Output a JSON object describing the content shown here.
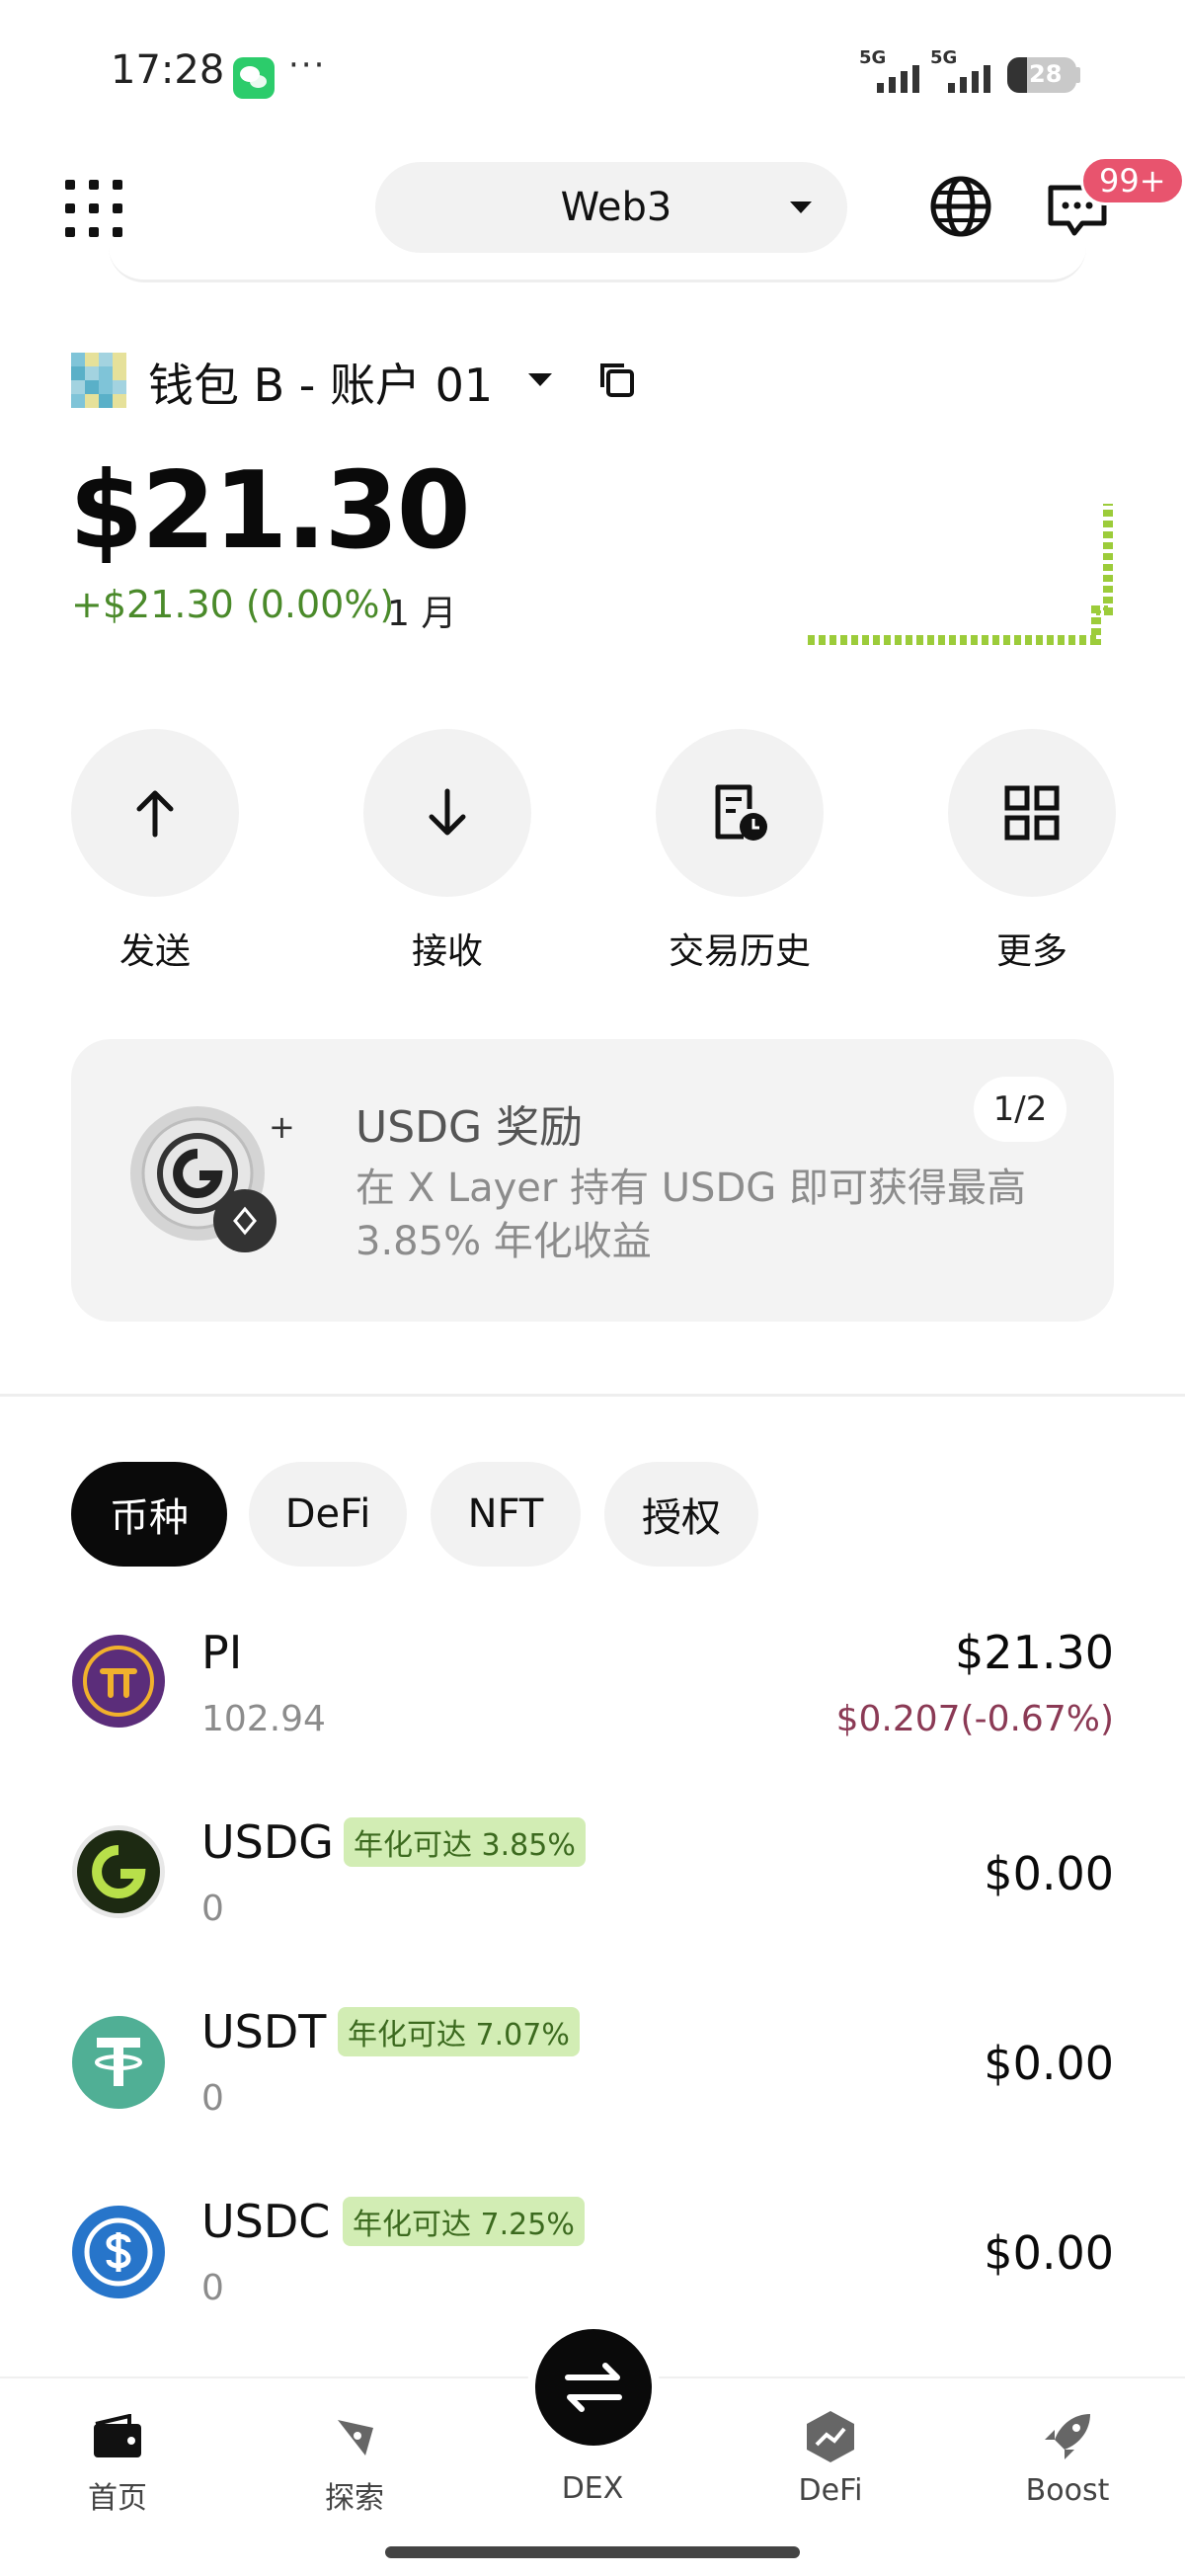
{
  "status_bar": {
    "time": "17:28",
    "more_dots": "···",
    "signal_1_label": "5G",
    "signal_2_label": "5G",
    "battery": "28",
    "battery_level": 0.28
  },
  "header": {
    "network_label": "Web3",
    "message_badge": "99+",
    "icons": [
      "apps-grid-icon",
      "globe-icon",
      "chat-icon"
    ]
  },
  "wallet": {
    "name": "钱包 B - 账户 01",
    "balance": "$21.30",
    "change": "+$21.30 (0.00%)",
    "period": "1 月"
  },
  "actions": [
    {
      "label": "发送",
      "icon": "arrow-up-icon"
    },
    {
      "label": "接收",
      "icon": "arrow-down-icon"
    },
    {
      "label": "交易历史",
      "icon": "history-icon"
    },
    {
      "label": "更多",
      "icon": "more-grid-icon"
    }
  ],
  "reward": {
    "title": "USDG 奖励",
    "description": "在 X Layer 持有 USDG 即可获得最高 3.85% 年化收益",
    "page": "1/2",
    "plus": "+"
  },
  "tabs": [
    {
      "label": "币种",
      "active": true
    },
    {
      "label": "DeFi",
      "active": false
    },
    {
      "label": "NFT",
      "active": false
    },
    {
      "label": "授权",
      "active": false
    }
  ],
  "tokens": [
    {
      "name": "PI",
      "amount": "102.94",
      "value": "$21.30",
      "sub": "$0.207(-0.67%)",
      "apy": null,
      "color": "#5b2d7a"
    },
    {
      "name": "USDG",
      "amount": "0",
      "value": "$0.00",
      "sub": null,
      "apy": "年化可达 3.85%",
      "color": "#1d2a12"
    },
    {
      "name": "USDT",
      "amount": "0",
      "value": "$0.00",
      "sub": null,
      "apy": "年化可达 7.07%",
      "color": "#50af95"
    },
    {
      "name": "USDC",
      "amount": "0",
      "value": "$0.00",
      "sub": null,
      "apy": "年化可达 7.25%",
      "color": "#2775ca"
    }
  ],
  "bottom_nav": [
    {
      "label": "首页",
      "icon": "wallet-icon"
    },
    {
      "label": "探索",
      "icon": "compass-icon"
    },
    {
      "label": "DEX",
      "icon": "swap-icon"
    },
    {
      "label": "DeFi",
      "icon": "defi-chart-icon"
    },
    {
      "label": "Boost",
      "icon": "rocket-icon"
    }
  ],
  "colors": {
    "positive": "#4a8a2a",
    "negative": "#8b3a55",
    "sparkline": "#9ccc3a",
    "badge_red": "#e8546e",
    "apy_bg": "#d2edb4"
  }
}
